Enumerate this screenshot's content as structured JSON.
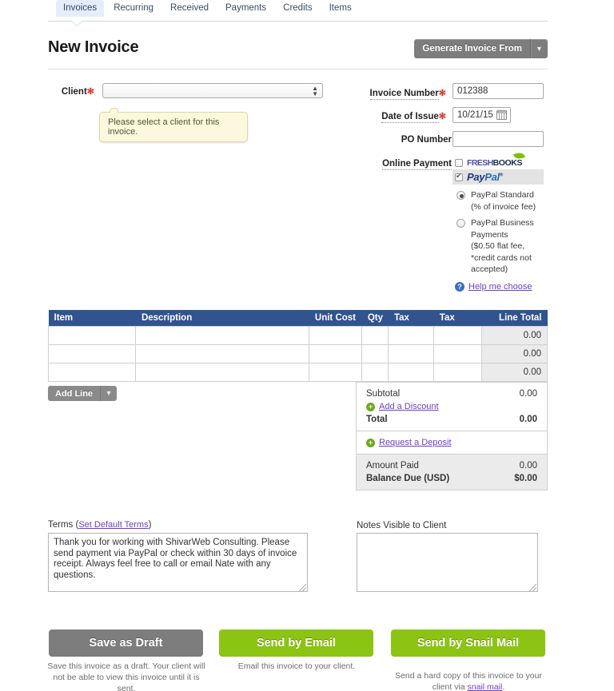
{
  "tabs": [
    {
      "label": "Invoices",
      "active": true
    },
    {
      "label": "Recurring",
      "active": false
    },
    {
      "label": "Received",
      "active": false
    },
    {
      "label": "Payments",
      "active": false
    },
    {
      "label": "Credits",
      "active": false
    },
    {
      "label": "Items",
      "active": false
    }
  ],
  "header": {
    "title": "New Invoice",
    "generate_button": "Generate Invoice From",
    "caret": "▼"
  },
  "form": {
    "client_label": "Client",
    "client_value": "",
    "required_mark": "✻",
    "tooltip": "Please select a client for this invoice.",
    "invoice_number_label": "Invoice Number",
    "invoice_number_value": "012388",
    "date_of_issue_label": "Date of Issue",
    "date_of_issue_value": "10/21/15",
    "po_number_label": "PO Number",
    "po_number_value": "",
    "online_payment_label": "Online Payment"
  },
  "payment": {
    "freshbooks_logo_a": "FRESH",
    "freshbooks_logo_b": "BOOKS",
    "paypal_logo_a": "Pay",
    "paypal_logo_b": "Pal",
    "paypal_tm": "®",
    "options": [
      {
        "selected": true,
        "title": "PayPal Standard",
        "detail": "(% of invoice fee)"
      },
      {
        "selected": false,
        "title": "PayPal Business Payments",
        "detail": "($0.50 flat fee, *credit cards not accepted)"
      }
    ],
    "help_link": "Help me choose",
    "help_icon_glyph": "?"
  },
  "items_table": {
    "columns": [
      {
        "label": "Item",
        "align": "left"
      },
      {
        "label": "Description",
        "align": "left"
      },
      {
        "label": "Unit Cost",
        "align": "right"
      },
      {
        "label": "Qty",
        "align": "right"
      },
      {
        "label": "Tax",
        "align": "left"
      },
      {
        "label": "Tax",
        "align": "left"
      },
      {
        "label": "Line Total",
        "align": "right"
      }
    ],
    "rows": [
      {
        "item": "",
        "description": "",
        "unit_cost": "",
        "qty": "",
        "tax1": "",
        "tax2": "",
        "line_total": "0.00"
      },
      {
        "item": "",
        "description": "",
        "unit_cost": "",
        "qty": "",
        "tax1": "",
        "tax2": "",
        "line_total": "0.00"
      },
      {
        "item": "",
        "description": "",
        "unit_cost": "",
        "qty": "",
        "tax1": "",
        "tax2": "",
        "line_total": "0.00"
      }
    ],
    "add_line_button": "Add Line",
    "add_line_caret": "▼"
  },
  "totals": {
    "subtotal_label": "Subtotal",
    "subtotal_value": "0.00",
    "add_discount_link": "Add a Discount",
    "total_label": "Total",
    "total_value": "0.00",
    "request_deposit_link": "Request a Deposit",
    "amount_paid_label": "Amount Paid",
    "amount_paid_value": "0.00",
    "balance_due_label": "Balance Due (USD)",
    "balance_due_value": "$0.00",
    "plus_glyph": "+"
  },
  "terms": {
    "label": "Terms (",
    "link": "Set Default Terms",
    "label_close": ")",
    "value": "Thank you for working with ShivarWeb Consulting. Please send payment via PayPal or check within 30 days of invoice receipt. Always feel free to call or email Nate with any questions."
  },
  "notes": {
    "label": "Notes Visible to Client",
    "value": "",
    "placeholder": ""
  },
  "footer": {
    "save_draft_button": "Save as Draft",
    "save_draft_caption": "Save this invoice as a draft. Your client will not be able to view this invoice until it is sent.",
    "send_email_button": "Send by Email",
    "send_email_caption": "Email this invoice to your client.",
    "send_mail_button": "Send by Snail Mail",
    "send_mail_caption_pre": "Send a hard copy of this invoice to your client via ",
    "send_mail_link": "snail mail",
    "send_mail_caption_post": "."
  },
  "colors": {
    "tab_active_bg": "#e4eefb",
    "table_header_blue": "#31538f",
    "button_green": "#8cc413",
    "button_gray": "#7d7d7d",
    "link_purple": "#6b3fcf",
    "required_red": "#d2342a",
    "tooltip_yellow": "#fbf8dd"
  }
}
